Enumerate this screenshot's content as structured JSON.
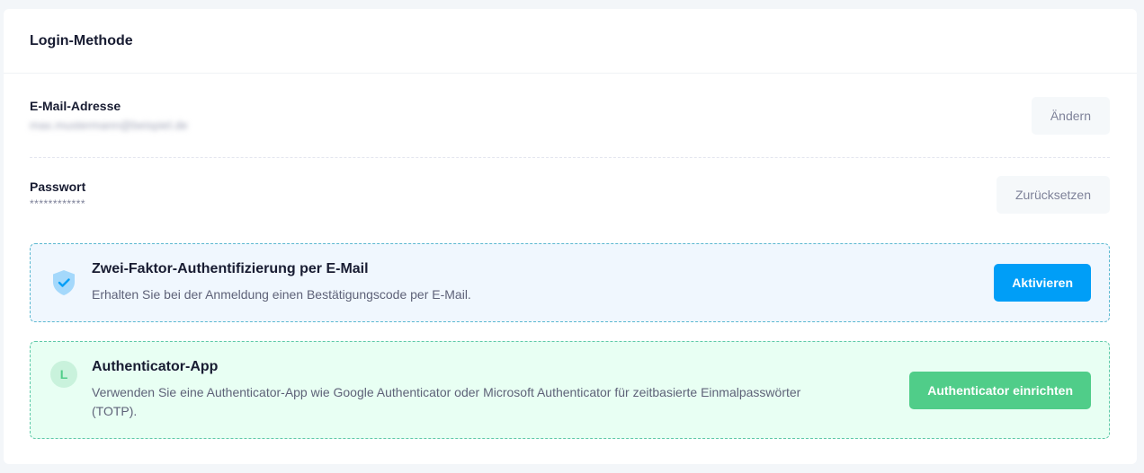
{
  "card": {
    "title": "Login-Methode"
  },
  "email": {
    "label": "E-Mail-Adresse",
    "value": "max.mustermann@beispiel.de",
    "change_label": "Ändern"
  },
  "password": {
    "label": "Passwort",
    "mask": "************",
    "reset_label": "Zurücksetzen"
  },
  "two_factor": {
    "icon": "shield-check-icon",
    "title": "Zwei-Faktor-Authentifizierung per E-Mail",
    "description": "Erhalten Sie bei der Anmeldung einen Bestätigungscode per E-Mail.",
    "button_label": "Aktivieren"
  },
  "authenticator": {
    "icon_letter": "L",
    "title": "Authenticator-App",
    "description": "Verwenden Sie eine Authenticator-App wie Google Authenticator oder Microsoft Authenticator für zeitbasierte Einmalpasswörter (TOTP).",
    "button_label": "Authenticator einrichten"
  },
  "colors": {
    "primary": "#009ef7",
    "success": "#50cd89",
    "blue_bg": "#f0f7fe",
    "green_bg": "#e8fff3"
  }
}
